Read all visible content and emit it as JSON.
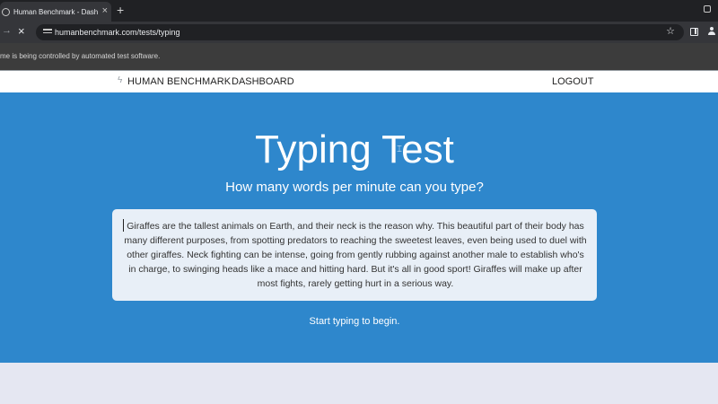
{
  "browser": {
    "tab_title": "Human Benchmark - Dashboard",
    "address_url": "humanbenchmark.com/tests/typing",
    "infobar_text": "me is being controlled by automated test software."
  },
  "nav": {
    "brand": "HUMAN BENCHMARK",
    "dashboard": "DASHBOARD",
    "logout": "LOGOUT"
  },
  "hero": {
    "title": "Typing Test",
    "subtitle": "How many words per minute can you type?",
    "passage": "Giraffes are the tallest animals on Earth, and their neck is the reason why. This beautiful part of their body has many different purposes, from spotting predators to reaching the sweetest leaves, even being used to duel with other giraffes. Neck fighting can be intense, going from gently rubbing against another male to establish who's in charge, to swinging heads like a mace and hitting hard. But it's all in good sport! Giraffes will make up after most fights, rarely getting hurt in a serious way.",
    "hint": "Start typing to begin."
  },
  "icons": {
    "brand_icon": "lightning-bolt-icon",
    "accent_color": "#2e87cc"
  }
}
